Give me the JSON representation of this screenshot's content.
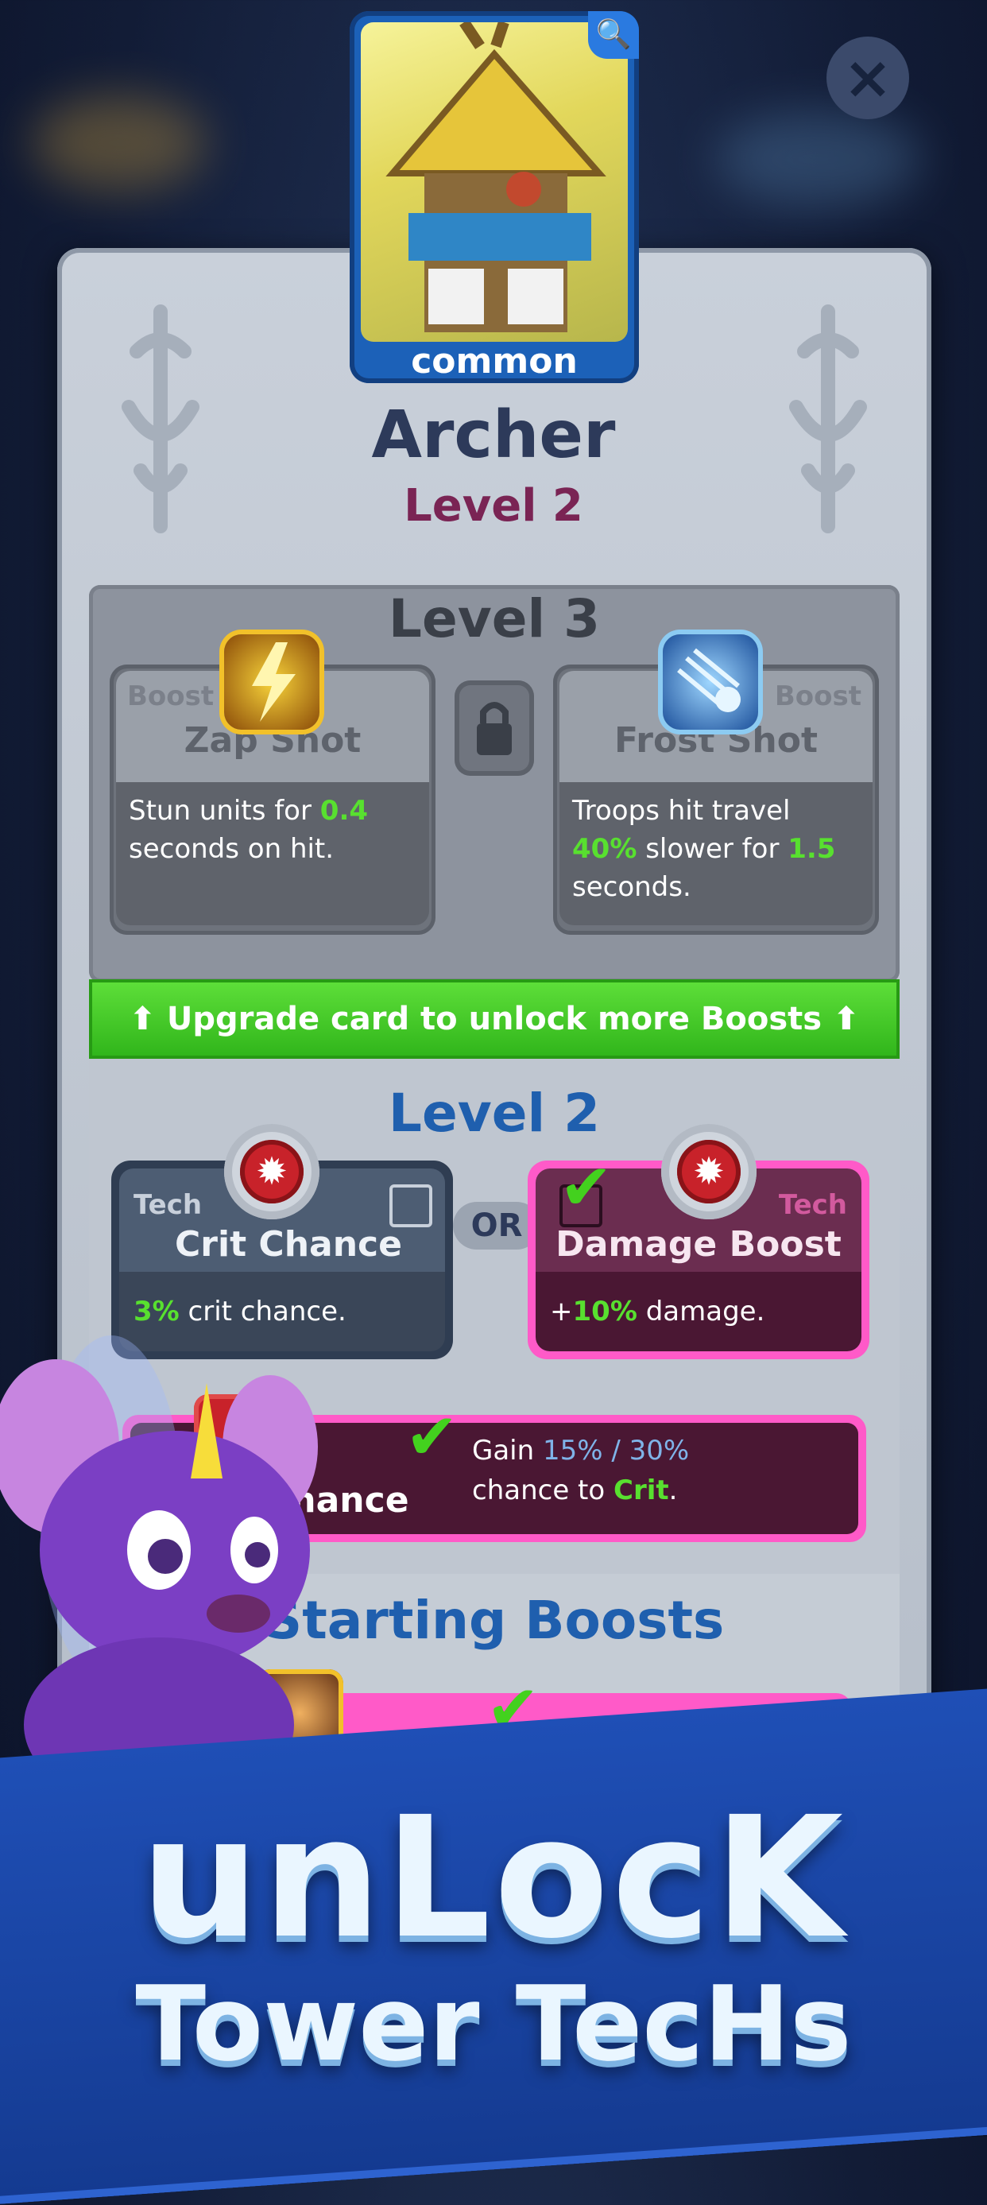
{
  "close_icon": "close-icon",
  "card": {
    "rarity": "common",
    "search_icon": "search-icon"
  },
  "tower": {
    "name": "Archer",
    "level": "Level 2"
  },
  "level3": {
    "title": "Level 3",
    "left": {
      "tag": "Boost",
      "name": "Zap Shot",
      "desc_a": "Stun units for ",
      "desc_val": "0.4",
      "desc_b": "seconds on hit."
    },
    "right": {
      "tag": "Boost",
      "name": "Frost Shot",
      "desc_a": "Troops hit travel",
      "desc_val1": "40%",
      "desc_mid": " slower for ",
      "desc_val2": "1.5",
      "desc_b": "seconds."
    },
    "lock_icon": "lock-icon"
  },
  "upgrade_bar": {
    "text": "Upgrade card to unlock more Boosts"
  },
  "level2": {
    "title": "Level 2",
    "or": "OR",
    "left": {
      "tag": "Tech",
      "name": "Crit Chance",
      "desc_val": "3%",
      "desc_b": " crit chance."
    },
    "right": {
      "tag": "Tech",
      "name": "Damage Boost",
      "desc_a": "+",
      "desc_val": "10%",
      "desc_b": " damage."
    },
    "selected": {
      "name": "Chance",
      "desc_a": "Gain ",
      "desc_val": "15% / 30%",
      "desc_b": "chance to ",
      "desc_crit": "Crit",
      "desc_end": "."
    }
  },
  "starting": {
    "title": "Starting Boosts"
  },
  "headline": {
    "line1": "unLocK",
    "line2": "Tower TecHs"
  },
  "colors": {
    "accent_green": "#58e02f",
    "title_blue": "#1f5fae",
    "level_maroon": "#7a2454",
    "selected_pink": "#ff5ac8"
  }
}
